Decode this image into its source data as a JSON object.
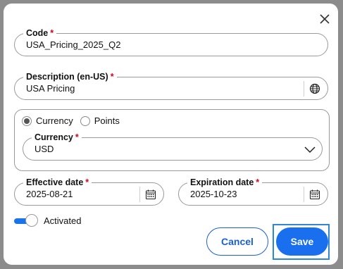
{
  "dialog": {
    "code": {
      "label": "Code",
      "required": "*",
      "value": "USA_Pricing_2025_Q2"
    },
    "description": {
      "label": "Description (en-US)",
      "required": "*",
      "value": "USA Pricing"
    },
    "type_radio": {
      "options": [
        "Currency",
        "Points"
      ],
      "selected": "Currency"
    },
    "currency": {
      "label": "Currency",
      "required": "*",
      "value": "USD"
    },
    "effective_date": {
      "label": "Effective date",
      "required": "*",
      "value": "2025-08-21"
    },
    "expiration_date": {
      "label": "Expiration date",
      "required": "*",
      "value": "2025-10-23"
    },
    "activated": {
      "label": "Activated",
      "on": true
    },
    "buttons": {
      "cancel": "Cancel",
      "save": "Save"
    }
  },
  "icons": {
    "close": "close-icon",
    "globe": "globe-icon",
    "chevron": "chevron-down-icon",
    "calendar": "calendar-icon"
  },
  "colors": {
    "accent": "#1a6fef",
    "required": "#d6001c",
    "focus_outline": "#2f86d6"
  }
}
